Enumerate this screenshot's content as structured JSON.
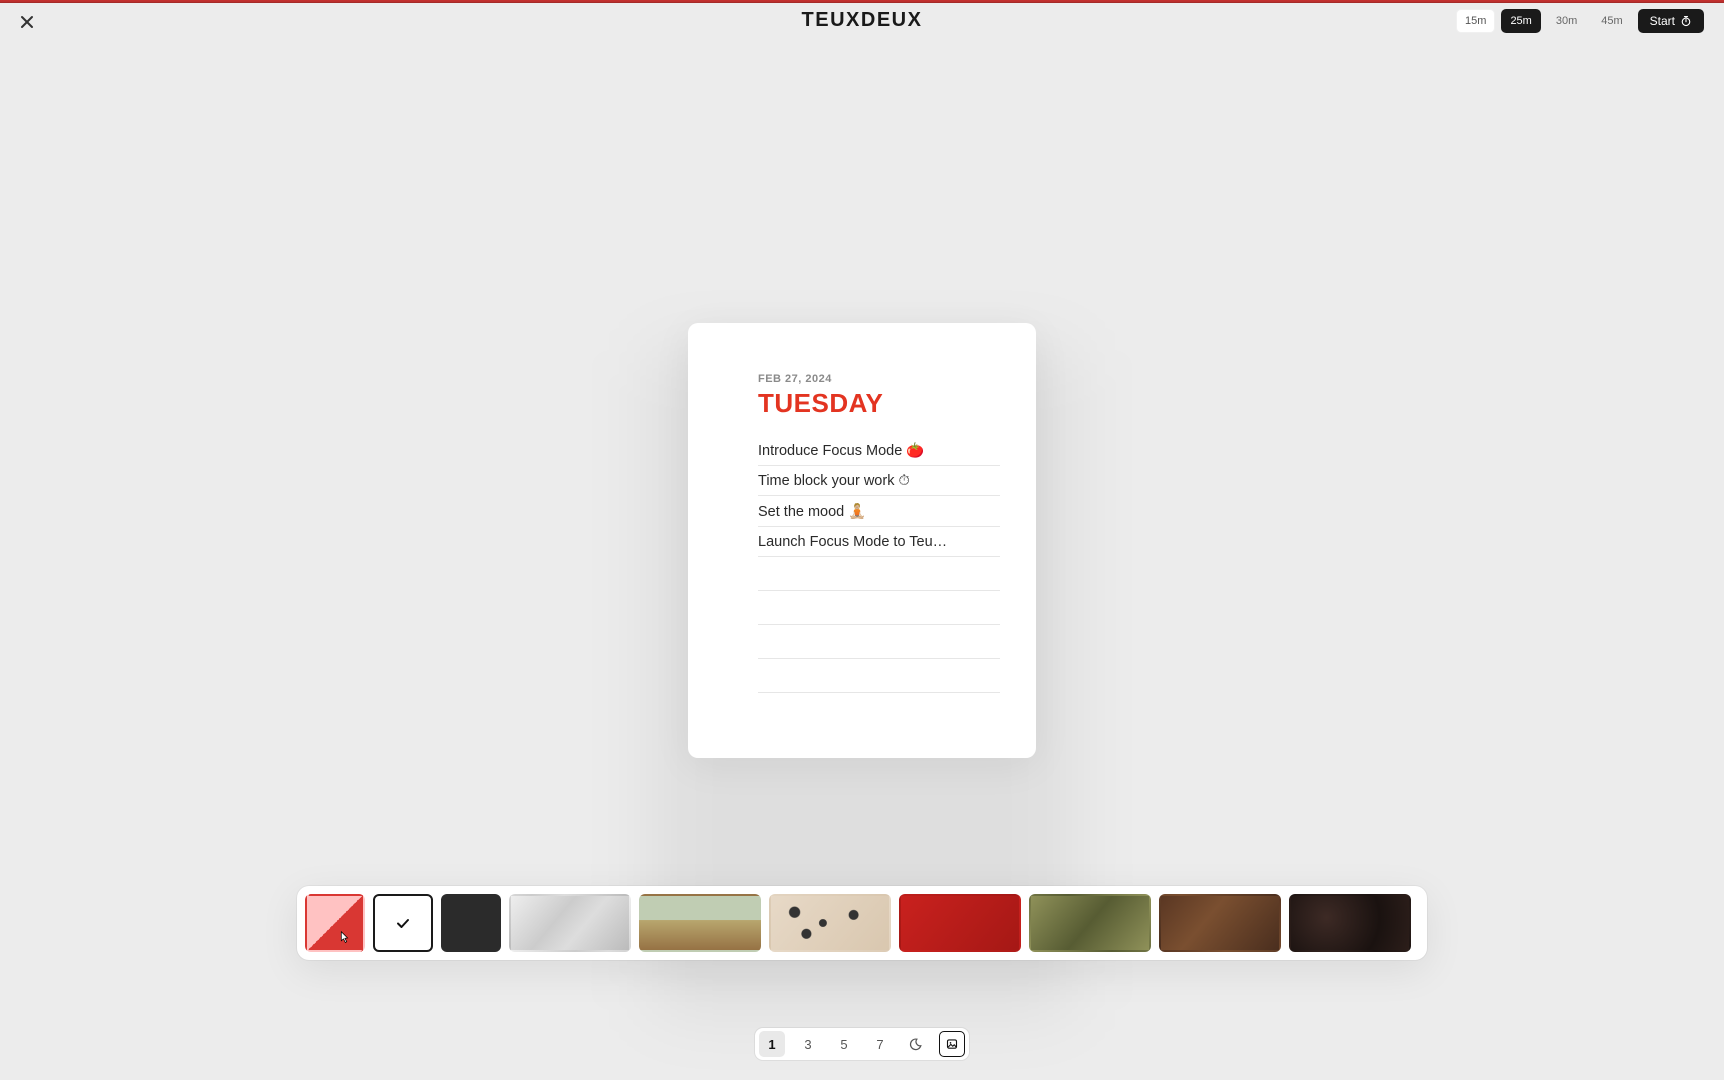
{
  "brand": "TEUXDEUX",
  "timer": {
    "options": [
      "15m",
      "25m",
      "30m",
      "45m"
    ],
    "selected_index": 1,
    "start_label": "Start"
  },
  "card": {
    "date_sub": "FEB 27, 2024",
    "day": "TUESDAY",
    "tasks": [
      "Introduce Focus Mode 🍅",
      "Time block your work ⏱",
      "Set the mood 🧘🏼",
      "Launch Focus Mode to Teu…"
    ],
    "empty_rows": 4
  },
  "bottom_bar": {
    "counts": [
      "1",
      "3",
      "5",
      "7"
    ],
    "active_count_index": 0,
    "image_picker_active": true
  },
  "themes": {
    "selected_index": 1,
    "hover_index": 0
  }
}
